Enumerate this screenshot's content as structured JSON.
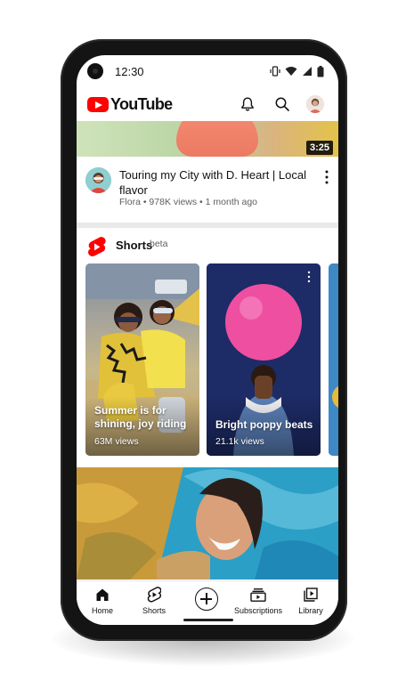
{
  "status_bar": {
    "time": "12:30",
    "icons": [
      "vibrate-icon",
      "wifi-icon",
      "signal-icon",
      "battery-icon"
    ]
  },
  "header": {
    "logo_text": "YouTube",
    "icons": [
      "bell-icon",
      "search-icon",
      "account-avatar"
    ]
  },
  "featured_video": {
    "duration": "3:25",
    "title": "Touring my City with D. Heart  | Local flavor",
    "channel": "Flora",
    "meta": "Flora • 978K views • 1 month ago"
  },
  "shorts": {
    "label": "Shorts",
    "badge": "beta",
    "items": [
      {
        "title": "Summer is for shining, joy riding",
        "views": "63M views"
      },
      {
        "title": "Bright poppy beats",
        "views": "21.1k views"
      }
    ]
  },
  "bottom_nav": {
    "items": [
      {
        "label": "Home",
        "icon": "home-icon",
        "active": true
      },
      {
        "label": "Shorts",
        "icon": "shorts-icon"
      },
      {
        "label": "",
        "icon": "create-plus-icon"
      },
      {
        "label": "Subscriptions",
        "icon": "subscriptions-icon"
      },
      {
        "label": "Library",
        "icon": "library-icon"
      }
    ]
  },
  "colors": {
    "brand_red": "#ff0000",
    "text_primary": "#111111",
    "text_secondary": "#606060"
  }
}
